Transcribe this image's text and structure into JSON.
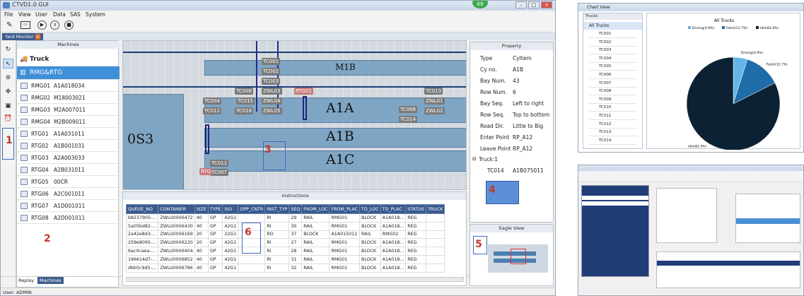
{
  "window": {
    "title": "CTVD1.0 GUI",
    "badge": "69"
  },
  "menu": [
    "File",
    "View",
    "User",
    "Data",
    "SAS",
    "System"
  ],
  "tab": "Yard Monitor",
  "machines": {
    "header": "Machines",
    "truck": "Truck",
    "group": "RMG&RTG",
    "rows": [
      {
        "n": "RMG01",
        "v": "A1A018034"
      },
      {
        "n": "RMG02",
        "v": "M18003021"
      },
      {
        "n": "RMG03",
        "v": "M2A007011"
      },
      {
        "n": "RMG04",
        "v": "M2B009011"
      },
      {
        "n": "RTG01",
        "v": "A1A031011"
      },
      {
        "n": "RTG02",
        "v": "A1B001031"
      },
      {
        "n": "RTG03",
        "v": "A2A003033"
      },
      {
        "n": "RTG04",
        "v": "A2B031011"
      },
      {
        "n": "RTG05",
        "v": "00CR"
      },
      {
        "n": "RTG06",
        "v": "A2C001011"
      },
      {
        "n": "RTG07",
        "v": "A1D001011"
      },
      {
        "n": "RTG08",
        "v": "A2D001011"
      }
    ]
  },
  "bottom_tabs": [
    "Replay",
    "Machines"
  ],
  "status": "User: ADMIN",
  "map": {
    "blocks": [
      "M1B",
      "A1A",
      "A1B",
      "A1C",
      "0S3"
    ],
    "labels": [
      "TC001",
      "TC002",
      "TC003",
      "ZWL03",
      "TC004",
      "TC008",
      "TC015",
      "ZWL04",
      "TC012",
      "TC016",
      "ZWL05",
      "RTG01",
      "TC013",
      "ZWL01",
      "TC006",
      "ZWL02",
      "TC014",
      "TC011",
      "TC007",
      "RTG"
    ]
  },
  "property": {
    "header": "Property",
    "rows": [
      {
        "k": "Type",
        "v": "CyItem"
      },
      {
        "k": "Cy no.",
        "v": "A1B"
      },
      {
        "k": "Bay Num.",
        "v": "43"
      },
      {
        "k": "Row Num.",
        "v": "6"
      },
      {
        "k": "Bay Seq.",
        "v": "Left to right"
      },
      {
        "k": "Row Seq.",
        "v": "Top to bottom"
      },
      {
        "k": "Road Dir.",
        "v": "Little to Big"
      },
      {
        "k": "Enter Point",
        "v": "RP_A12"
      },
      {
        "k": "Leave Point",
        "v": "RP_A12"
      }
    ],
    "truck_label": "Truck:1",
    "truck_row": {
      "k": "TC014",
      "v": "A1B075011"
    }
  },
  "instructions": {
    "header": "Instructions",
    "columns": [
      "QUEUE_NO",
      "CONTAINER",
      "SIZE",
      "TYPE",
      "ISO",
      "OPP_CNTR",
      "INST_TYP",
      "SEQ",
      "FROM_LOC",
      "FROM_PLAC",
      "TO_LOC",
      "TO_PLAC",
      "STATUS",
      "TRUCK"
    ],
    "rows": [
      [
        "b8237905-...",
        "ZWLU0006472",
        "40",
        "GP",
        "42G1",
        "",
        "RI",
        "29",
        "RAIL",
        "RMG01",
        "BLOCK",
        "A1A018...",
        "REG",
        ""
      ],
      [
        "5a05bd82-...",
        "ZWLU0006430",
        "40",
        "GP",
        "42G1",
        "",
        "RI",
        "30",
        "RAIL",
        "RMG01",
        "BLOCK",
        "A1A018...",
        "REG",
        ""
      ],
      [
        "2a42e8d3-...",
        "ZWLU0006169",
        "20",
        "GP",
        "22G1",
        "",
        "RO",
        "37",
        "BLOCK",
        "A1A015011",
        "RAIL",
        "RMG02",
        "REG",
        ""
      ],
      [
        "259e8095-...",
        "ZWLU0006220",
        "20",
        "GP",
        "42G1",
        "",
        "RI",
        "27",
        "RAIL",
        "RMG01",
        "BLOCK",
        "A1A018...",
        "REG",
        ""
      ],
      [
        "6ac0caea-...",
        "ZWLU0006404",
        "40",
        "GP",
        "42G1",
        "",
        "RI",
        "28",
        "RAIL",
        "RMG01",
        "BLOCK",
        "A1A018...",
        "REG",
        ""
      ],
      [
        "196614d7-...",
        "ZWLU0006852",
        "40",
        "GP",
        "42G1",
        "",
        "RI",
        "31",
        "RAIL",
        "RMG01",
        "BLOCK",
        "A1A018...",
        "REG",
        ""
      ],
      [
        "dbb5c9d5-...",
        "ZWLU0006786",
        "40",
        "GP",
        "42G1",
        "",
        "RI",
        "32",
        "RAIL",
        "RMG01",
        "BLOCK",
        "A1A018...",
        "REG",
        ""
      ]
    ]
  },
  "eagle": {
    "header": "Eagle View"
  },
  "annotations": [
    "1",
    "2",
    "3",
    "4",
    "5",
    "6"
  ],
  "chart": {
    "window_title": "Chart View",
    "panel_header": "Trucks",
    "list_all": "All Trucks",
    "list": [
      "TC001",
      "TC002",
      "TC003",
      "TC004",
      "TC005",
      "TC006",
      "TC007",
      "TC008",
      "TC009",
      "TC010",
      "TC011",
      "TC012",
      "TC013",
      "TC014"
    ],
    "legend": [
      "Driving(4.9%)",
      "Fetch(12.7%)",
      "Idle(82.4%)"
    ],
    "colors": [
      "#64b5e8",
      "#1f6da8",
      "#0c2234"
    ]
  },
  "chart_data": {
    "type": "pie",
    "title": "All Trucks",
    "categories": [
      "Driving",
      "Fetch",
      "Idle"
    ],
    "values": [
      4.9,
      12.7,
      82.4
    ]
  }
}
